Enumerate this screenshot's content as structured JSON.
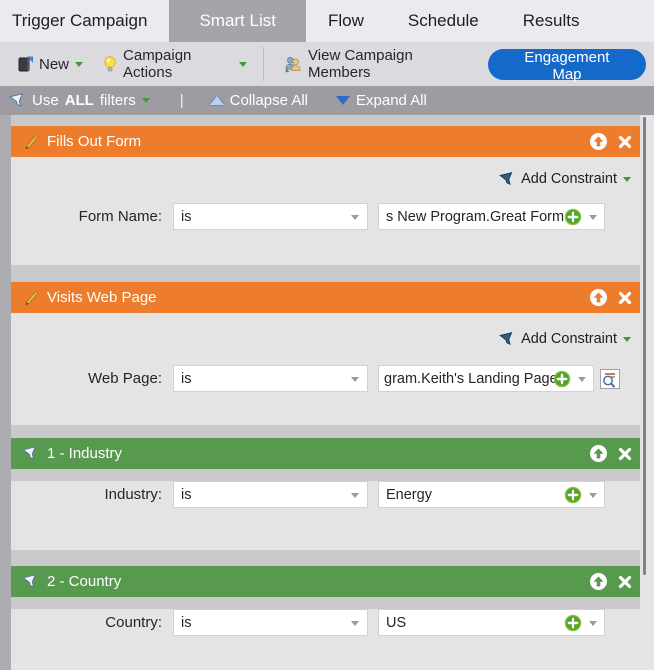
{
  "tab_bar": {
    "tabs": [
      {
        "label": "Trigger Campaign",
        "active": false
      },
      {
        "label": "Smart List",
        "active": true
      },
      {
        "label": "Flow",
        "active": false
      },
      {
        "label": "Schedule",
        "active": false
      },
      {
        "label": "Results",
        "active": false
      }
    ]
  },
  "toolbar": {
    "new": "New",
    "campaign_actions": "Campaign Actions",
    "view_campaign_members": "View Campaign Members",
    "engagement_map": "Engagement Map"
  },
  "filter_bar": {
    "use_filters_prefix": "Use",
    "use_filters_bold": "ALL",
    "use_filters_suffix": "filters",
    "divider": "|",
    "collapse_all": "Collapse All",
    "expand_all": "Expand All"
  },
  "panels": [
    {
      "title": "Fills Out Form",
      "add_constraint": "Add Constraint",
      "field_label": "Form Name:",
      "operator": "is",
      "value": "s New Program.Great Form"
    },
    {
      "title": "Visits Web Page",
      "add_constraint": "Add Constraint",
      "field_label": "Web Page:",
      "operator": "is",
      "value": "gram.Keith's Landing Page"
    },
    {
      "title": "1 - Industry",
      "field_label": "Industry:",
      "operator": "is",
      "value": "Energy"
    },
    {
      "title": "2 - Country",
      "field_label": "Country:",
      "operator": "is",
      "value": "US"
    }
  ],
  "colors": {
    "trigger_panel_header": "#EE7C2D",
    "filter_panel_header": "#57994F",
    "engagement_button": "#1569C8",
    "active_tab": "#A4A4AA",
    "filter_bar_bg": "#9C9CA2",
    "green_plus": "#4FA22C",
    "dropdown_caret_green": "#3F9C35"
  }
}
